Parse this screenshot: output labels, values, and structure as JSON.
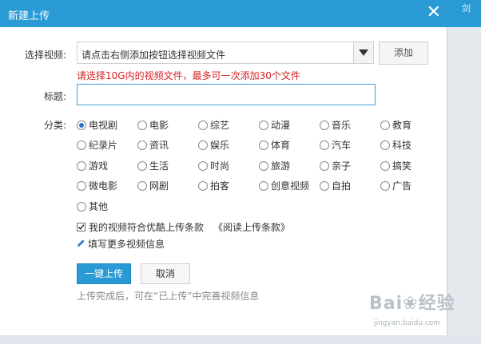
{
  "dialog": {
    "title": "新建上传",
    "close_icon": "close-icon"
  },
  "form": {
    "video_label": "选择视频:",
    "video_select_text": "请点击右侧添加按钮选择视频文件",
    "add_button": "添加",
    "video_hint": "请选择10G内的视频文件，最多可一次添加30个文件",
    "title_label": "标题:",
    "title_value": "",
    "category_label": "分类:",
    "categories": [
      "电视剧",
      "电影",
      "综艺",
      "动漫",
      "音乐",
      "教育",
      "纪录片",
      "资讯",
      "娱乐",
      "体育",
      "汽车",
      "科技",
      "游戏",
      "生活",
      "时尚",
      "旅游",
      "亲子",
      "搞笑",
      "微电影",
      "网剧",
      "拍客",
      "创意视频",
      "自拍",
      "广告",
      "其他"
    ],
    "selected_category": "电视剧",
    "agree_text": "我的视频符合优酷上传条款",
    "agree_checked": true,
    "agree_link": "《阅读上传条款》",
    "more_info": "填写更多视频信息",
    "upload_button": "一键上传",
    "cancel_button": "取消",
    "note": "上传完成后，可在“已上传”中完善视频信息"
  },
  "background": {
    "tab_text": "剑"
  },
  "watermark": {
    "logo": "Bai❀经验",
    "url": "jingyan.baidu.com"
  },
  "colors": {
    "accent": "#2a9ad5",
    "hint_red": "#d42020",
    "radio_selected": "#2a6fd6"
  }
}
